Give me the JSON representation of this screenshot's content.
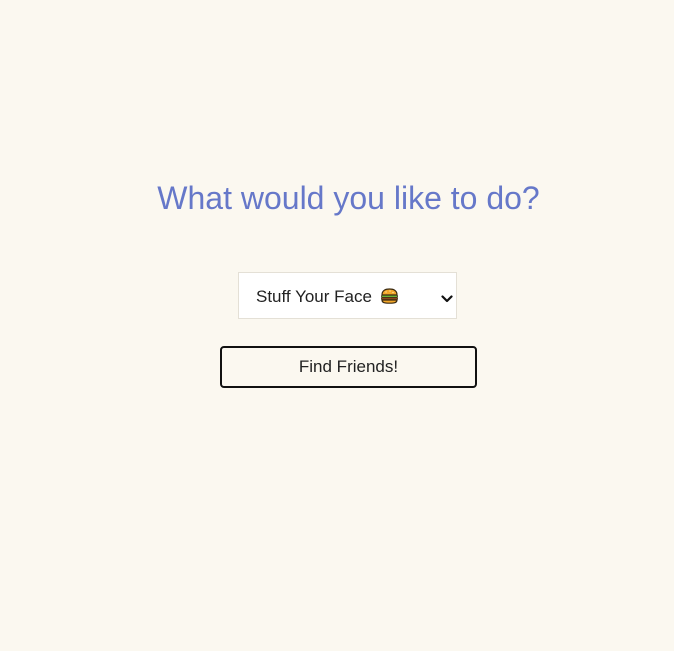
{
  "heading": "What would you like to do?",
  "activity_select": {
    "selected_label": "Stuff Your Face",
    "selected_icon": "hamburger-icon"
  },
  "find_button_label": "Find Friends!",
  "colors": {
    "background": "#fbf8f0",
    "heading": "#6678c9",
    "button_border": "#111111"
  }
}
